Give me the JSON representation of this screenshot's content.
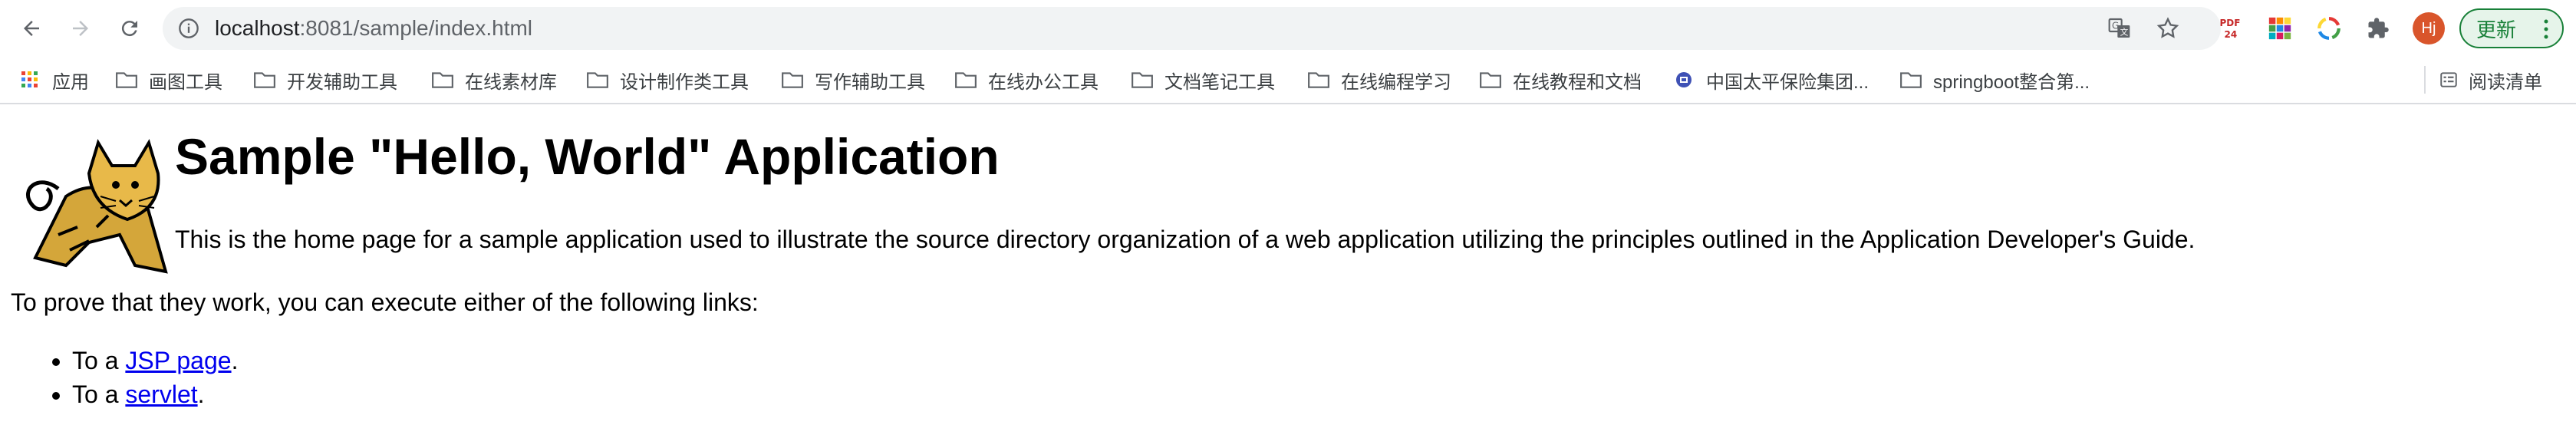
{
  "browser": {
    "url_host": "localhost",
    "url_path": ":8081/sample/index.html",
    "avatar_text": "Hj",
    "update_label": "更新",
    "extensions": [
      "translate-icon",
      "star-icon",
      "pdf24-icon",
      "color-grid-icon",
      "sync-icon",
      "puzzle-icon"
    ]
  },
  "bookmarks": [
    {
      "label": "应用",
      "icon": "apps-grid-icon"
    },
    {
      "label": "画图工具",
      "icon": "folder-icon"
    },
    {
      "label": "开发辅助工具",
      "icon": "folder-icon"
    },
    {
      "label": "在线素材库",
      "icon": "folder-icon"
    },
    {
      "label": "设计制作类工具",
      "icon": "folder-icon"
    },
    {
      "label": "写作辅助工具",
      "icon": "folder-icon"
    },
    {
      "label": "在线办公工具",
      "icon": "folder-icon"
    },
    {
      "label": "文档笔记工具",
      "icon": "folder-icon"
    },
    {
      "label": "在线编程学习",
      "icon": "folder-icon"
    },
    {
      "label": "在线教程和文档",
      "icon": "folder-icon"
    },
    {
      "label": "中国太平保险集团...",
      "icon": "site-icon"
    },
    {
      "label": "springboot整合第...",
      "icon": "folder-icon"
    }
  ],
  "reading_list": "阅读清单",
  "page": {
    "title": "Sample \"Hello, World\" Application",
    "intro": "This is the home page for a sample application used to illustrate the source directory organization of a web application utilizing the principles outlined in the Application Developer's Guide.",
    "prove": "To prove that they work, you can execute either of the following links:",
    "links": [
      {
        "prefix": "To a ",
        "text": "JSP page",
        "suffix": "."
      },
      {
        "prefix": "To a ",
        "text": "servlet",
        "suffix": "."
      }
    ]
  }
}
